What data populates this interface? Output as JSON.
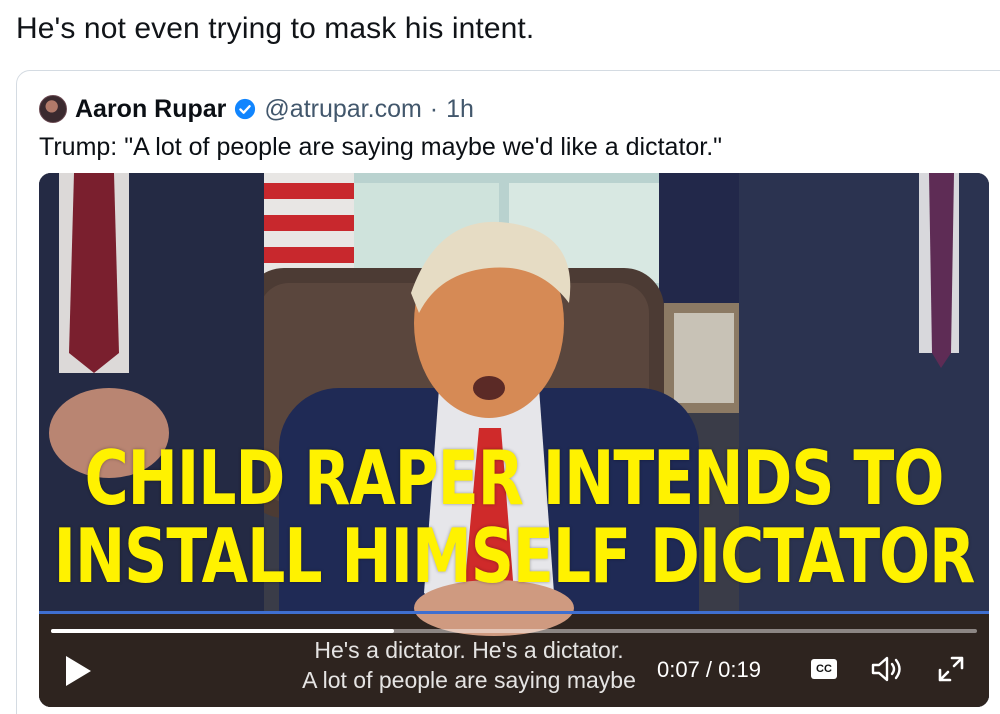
{
  "post": {
    "text": "He's not even trying to mask his intent."
  },
  "quoted_post": {
    "author_name": "Aaron Rupar",
    "handle": "@atrupar.com",
    "separator": "·",
    "timestamp": "1h",
    "text": "Trump: \"A lot of people are saying maybe we'd like a dictator.\""
  },
  "video": {
    "overlay_line1": "CHILD RAPER INTENDS TO",
    "overlay_line2": "INSTALL HIMSELF DICTATOR",
    "subtitle_line1": "He's a dictator. He's a dictator.",
    "subtitle_line2": "A lot of people are saying maybe",
    "time_display": "0:07 / 0:19",
    "progress_fraction": 0.37,
    "cc_label": "CC",
    "overlay_color": "#fff200",
    "accent_color": "#3f6fd0"
  },
  "icons": {
    "verified": "verified-badge-icon",
    "play": "play-icon",
    "volume": "volume-icon",
    "fullscreen": "fullscreen-icon"
  }
}
